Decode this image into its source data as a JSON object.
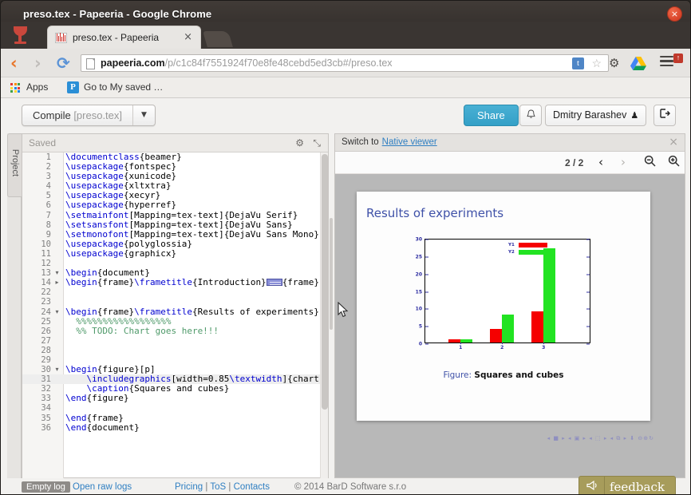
{
  "window": {
    "title": "preso.tex - Papeeria - Google Chrome",
    "close_label": "×"
  },
  "browser": {
    "tab": {
      "title": "preso.tex - Papeeria",
      "close_label": "×",
      "favicon": "barcode-icon"
    },
    "nav": {
      "back": "‹",
      "forward": "›",
      "reload": "⟳"
    },
    "omnibox": {
      "url_host": "papeeria.com",
      "url_path": "/p/c1c84f7551924f70e8fe48cebd5ed3cb#/preso.tex",
      "badge_letter": "t",
      "star": "☆"
    },
    "extensions": {
      "gear": "⚙",
      "menu_badge": "↑"
    },
    "bookmarks": {
      "apps_label": "Apps",
      "saved_icon_letter": "P",
      "saved_label": "Go to My saved …"
    }
  },
  "app": {
    "toolbar": {
      "compile_label": "Compile",
      "compile_file": "[preso.tex]",
      "compile_caret": "▼",
      "share_label": "Share",
      "bell_icon": "♩",
      "user_name": "Dmitry Barashev",
      "user_icon": "♟",
      "logout_icon": "⇥"
    },
    "rail": {
      "project_label": "Project"
    },
    "editor": {
      "status": "Saved",
      "gear_icon": "⚙",
      "expand_icon": "⤡",
      "lines": [
        {
          "n": "1",
          "fold": "",
          "tokens": [
            {
              "t": "\\documentclass",
              "c": "k"
            },
            {
              "t": "{beamer}",
              "c": ""
            }
          ]
        },
        {
          "n": "2",
          "fold": "",
          "tokens": [
            {
              "t": "\\usepackage",
              "c": "k"
            },
            {
              "t": "{fontspec}",
              "c": ""
            }
          ]
        },
        {
          "n": "3",
          "fold": "",
          "tokens": [
            {
              "t": "\\usepackage",
              "c": "k"
            },
            {
              "t": "{xunicode}",
              "c": ""
            }
          ]
        },
        {
          "n": "4",
          "fold": "",
          "tokens": [
            {
              "t": "\\usepackage",
              "c": "k"
            },
            {
              "t": "{xltxtra}",
              "c": ""
            }
          ]
        },
        {
          "n": "5",
          "fold": "",
          "tokens": [
            {
              "t": "\\usepackage",
              "c": "k"
            },
            {
              "t": "{xecyr}",
              "c": ""
            }
          ]
        },
        {
          "n": "6",
          "fold": "",
          "tokens": [
            {
              "t": "\\usepackage",
              "c": "k"
            },
            {
              "t": "{hyperref}",
              "c": ""
            }
          ]
        },
        {
          "n": "7",
          "fold": "",
          "tokens": [
            {
              "t": "\\setmainfont",
              "c": "k"
            },
            {
              "t": "[Mapping=tex-text]{DejaVu Serif}",
              "c": ""
            }
          ]
        },
        {
          "n": "8",
          "fold": "",
          "tokens": [
            {
              "t": "\\setsansfont",
              "c": "k"
            },
            {
              "t": "[Mapping=tex-text]{DejaVu Sans}",
              "c": ""
            }
          ]
        },
        {
          "n": "9",
          "fold": "",
          "tokens": [
            {
              "t": "\\setmonofont",
              "c": "k"
            },
            {
              "t": "[Mapping=tex-text]{DejaVu Sans Mono}",
              "c": ""
            }
          ]
        },
        {
          "n": "10",
          "fold": "",
          "tokens": [
            {
              "t": "\\usepackage",
              "c": "k"
            },
            {
              "t": "{polyglossia}",
              "c": ""
            }
          ]
        },
        {
          "n": "11",
          "fold": "",
          "tokens": [
            {
              "t": "\\usepackage",
              "c": "k"
            },
            {
              "t": "{graphicx}",
              "c": ""
            }
          ]
        },
        {
          "n": "12",
          "fold": "",
          "tokens": []
        },
        {
          "n": "13",
          "fold": "▾",
          "tokens": [
            {
              "t": "\\begin",
              "c": "k"
            },
            {
              "t": "{document}",
              "c": ""
            }
          ]
        },
        {
          "n": "14",
          "fold": "▸",
          "tokens": [
            {
              "t": "\\begin",
              "c": "k"
            },
            {
              "t": "{frame}",
              "c": ""
            },
            {
              "t": "\\frametitle",
              "c": "k"
            },
            {
              "t": "{Introduction}",
              "c": ""
            },
            {
              "t": "",
              "c": "blk"
            },
            {
              "t": "{frame}",
              "c": ""
            }
          ]
        },
        {
          "n": "22",
          "fold": "",
          "tokens": []
        },
        {
          "n": "23",
          "fold": "",
          "tokens": []
        },
        {
          "n": "24",
          "fold": "▾",
          "tokens": [
            {
              "t": "\\begin",
              "c": "k"
            },
            {
              "t": "{frame}",
              "c": ""
            },
            {
              "t": "\\frametitle",
              "c": "k"
            },
            {
              "t": "{Results of experiments}",
              "c": ""
            }
          ]
        },
        {
          "n": "25",
          "fold": "",
          "tokens": [
            {
              "t": "  %%%%%%%%%%%%%%%%%%",
              "c": "cm"
            }
          ]
        },
        {
          "n": "26",
          "fold": "",
          "tokens": [
            {
              "t": "  %% TODO: Chart goes here!!!",
              "c": "cm"
            }
          ]
        },
        {
          "n": "27",
          "fold": "",
          "tokens": []
        },
        {
          "n": "28",
          "fold": "",
          "tokens": []
        },
        {
          "n": "29",
          "fold": "",
          "tokens": []
        },
        {
          "n": "30",
          "fold": "▾",
          "tokens": [
            {
              "t": "\\begin",
              "c": "k"
            },
            {
              "t": "{figure}[p]",
              "c": ""
            }
          ]
        },
        {
          "n": "31",
          "fold": "",
          "hl": true,
          "tokens": [
            {
              "t": "    ",
              "c": ""
            },
            {
              "t": "\\includegraphics",
              "c": "k"
            },
            {
              "t": "[width=0.85",
              "c": ""
            },
            {
              "t": "\\textwidth",
              "c": "k"
            },
            {
              "t": "]{chart}",
              "c": ""
            }
          ]
        },
        {
          "n": "32",
          "fold": "",
          "tokens": [
            {
              "t": "    ",
              "c": ""
            },
            {
              "t": "\\caption",
              "c": "k"
            },
            {
              "t": "{Squares and cubes}",
              "c": ""
            }
          ]
        },
        {
          "n": "33",
          "fold": "",
          "tokens": [
            {
              "t": "\\end",
              "c": "k"
            },
            {
              "t": "{figure}",
              "c": ""
            }
          ]
        },
        {
          "n": "34",
          "fold": "",
          "tokens": []
        },
        {
          "n": "35",
          "fold": "",
          "tokens": [
            {
              "t": "\\end",
              "c": "k"
            },
            {
              "t": "{frame}",
              "c": ""
            }
          ]
        },
        {
          "n": "36",
          "fold": "",
          "tokens": [
            {
              "t": "\\end",
              "c": "k"
            },
            {
              "t": "{document}",
              "c": ""
            }
          ]
        }
      ]
    },
    "preview": {
      "switch_prefix": "Switch to",
      "switch_link": "Native viewer",
      "close_icon": "×",
      "pages": "2 / 2",
      "prev_icon": "‹",
      "next_icon": "›",
      "zoom_out_icon": "⊖",
      "zoom_in_icon": "⊕",
      "popout_icon": "↗",
      "mini_toolbar": "◂ ■ ▸  ◂ ▣ ▸  ◂ ⬚ ▸  ◂ ⧉ ▸   ⬇   ⊖⊕↻",
      "slide": {
        "title": "Results of experiments",
        "caption_prefix": "Figure:",
        "caption_text": "Squares and cubes"
      }
    },
    "footer": {
      "empty_log": "Empty log",
      "open_raw_logs": "Open raw logs",
      "pricing": "Pricing",
      "tos": "ToS",
      "contacts": "Contacts",
      "separator": "|",
      "copyright": "© 2014 BarD Software s.r.o",
      "feedback_label": "feedback",
      "feedback_icon": "📢"
    }
  },
  "chart_data": {
    "type": "bar",
    "title": "",
    "xlabel": "",
    "ylabel": "",
    "categories": [
      "1",
      "2",
      "3"
    ],
    "series": [
      {
        "name": "Y1",
        "color": "#f50000",
        "values": [
          1,
          4,
          9
        ]
      },
      {
        "name": "Y2",
        "color": "#22e322",
        "values": [
          1,
          8,
          27
        ]
      }
    ],
    "ylim": [
      0,
      30
    ],
    "yticks": [
      0,
      5,
      10,
      15,
      20,
      25,
      30
    ],
    "grid": false,
    "legend_position": "top-center",
    "caption": "Figure: Squares and cubes"
  },
  "colors": {
    "accent": "#34a0c7",
    "link": "#2f7fc2",
    "slide_title": "#3f51a8",
    "series1": "#f50000",
    "series2": "#22e322",
    "feedback": "#a79c5b"
  }
}
